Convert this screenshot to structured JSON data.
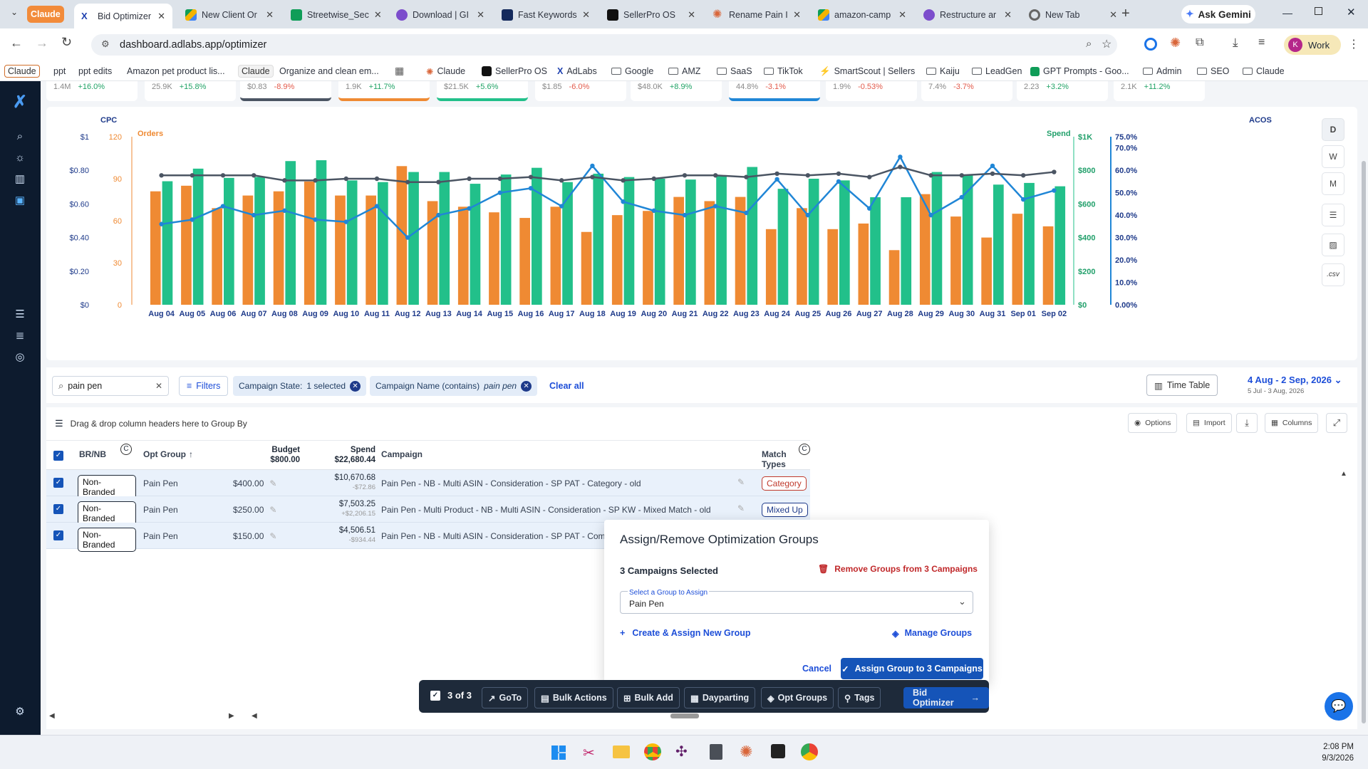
{
  "browser": {
    "tabs": [
      {
        "label": "Claude",
        "active": false
      },
      {
        "label": "Bid Optimizer",
        "active": true
      },
      {
        "label": "New Client Or",
        "active": false
      },
      {
        "label": "Streetwise_Sec",
        "active": false
      },
      {
        "label": "Download | GI",
        "active": false
      },
      {
        "label": "Fast Keywords",
        "active": false
      },
      {
        "label": "SellerPro OS",
        "active": false
      },
      {
        "label": "Rename Pain I",
        "active": false
      },
      {
        "label": "amazon-camp",
        "active": false
      },
      {
        "label": "Restructure ar",
        "active": false
      },
      {
        "label": "New Tab",
        "active": false
      }
    ],
    "ask_gemini": "Ask Gemini",
    "url": "dashboard.adlabs.app/optimizer",
    "profile": "Work",
    "profile_initial": "K",
    "bookmarks": [
      "Claude",
      "ppt",
      "ppt edits",
      "Amazon pet product lis...",
      "Claude",
      "Organize and clean em...",
      "Claude",
      "SellerPro OS",
      "AdLabs",
      "Google",
      "AMZ",
      "SaaS",
      "TikTok",
      "SmartScout | Sellers",
      "Kaiju",
      "LeadGen",
      "GPT Prompts - Goo...",
      "Admin",
      "SEO",
      "Claude"
    ]
  },
  "kpis": [
    {
      "value": "1.4M",
      "delta": "+16.0%",
      "dir": "up"
    },
    {
      "value": "25.9K",
      "delta": "+15.8%",
      "dir": "up"
    },
    {
      "value": "$0.83",
      "delta": "-8.9%",
      "dir": "dn"
    },
    {
      "value": "1.9K",
      "delta": "+11.7%",
      "dir": "up"
    },
    {
      "value": "$21.5K",
      "delta": "+5.6%",
      "dir": "up"
    },
    {
      "value": "$1.85",
      "delta": "-6.0%",
      "dir": "dn"
    },
    {
      "value": "$48.0K",
      "delta": "+8.9%",
      "dir": "up"
    },
    {
      "value": "44.8%",
      "delta": "-3.1%",
      "dir": "dn"
    },
    {
      "value": "1.9%",
      "delta": "-0.53%",
      "dir": "dn"
    },
    {
      "value": "7.4%",
      "delta": "-3.7%",
      "dir": "dn"
    },
    {
      "value": "2.23",
      "delta": "+3.2%",
      "dir": "up"
    },
    {
      "value": "2.1K",
      "delta": "+11.2%",
      "dir": "up"
    }
  ],
  "chart_data": {
    "type": "bar",
    "axis_titles": {
      "cpc": "CPC",
      "orders": "Orders",
      "spend": "Spend",
      "acos": "ACOS"
    },
    "cpc_ticks": [
      "$0",
      "$0.20",
      "$0.40",
      "$0.60",
      "$0.80",
      "$1"
    ],
    "orders_ticks": [
      "0",
      "30",
      "60",
      "90",
      "120"
    ],
    "spend_ticks": [
      "$0",
      "$200",
      "$400",
      "$600",
      "$800",
      "$1K"
    ],
    "acos_ticks": [
      "0.00%",
      "10.0%",
      "20.0%",
      "30.0%",
      "40.0%",
      "50.0%",
      "60.0%",
      "70.0%",
      "75.0%"
    ],
    "categories": [
      "Aug 04",
      "Aug 05",
      "Aug 06",
      "Aug 07",
      "Aug 08",
      "Aug 09",
      "Aug 10",
      "Aug 11",
      "Aug 12",
      "Aug 13",
      "Aug 14",
      "Aug 15",
      "Aug 16",
      "Aug 17",
      "Aug 18",
      "Aug 19",
      "Aug 20",
      "Aug 21",
      "Aug 22",
      "Aug 23",
      "Aug 24",
      "Aug 25",
      "Aug 26",
      "Aug 27",
      "Aug 28",
      "Aug 29",
      "Aug 30",
      "Aug 31",
      "Sep 01",
      "Sep 02"
    ],
    "series": [
      {
        "name": "Orders",
        "color": "#ef8a33",
        "values": [
          81,
          85,
          69,
          78,
          81,
          88,
          78,
          78,
          99,
          74,
          70,
          66,
          62,
          70,
          52,
          64,
          67,
          77,
          74,
          77,
          54,
          69,
          54,
          58,
          39,
          79,
          63,
          48,
          65,
          56
        ]
      },
      {
        "name": "Spend",
        "color": "#22c08a",
        "values": [
          735,
          810,
          755,
          760,
          855,
          860,
          740,
          730,
          790,
          790,
          720,
          775,
          815,
          730,
          780,
          760,
          750,
          745,
          770,
          820,
          690,
          750,
          740,
          640,
          640,
          790,
          770,
          715,
          725,
          705
        ]
      },
      {
        "name": "ACOS",
        "color": "#2086d6",
        "values": [
          36,
          38,
          44,
          40,
          42,
          38,
          37,
          44,
          30,
          40,
          43,
          50,
          52,
          44,
          62,
          46,
          42,
          40,
          44,
          41,
          56,
          40,
          55,
          43,
          66,
          40,
          48,
          62,
          47,
          51
        ]
      },
      {
        "name": "CPC",
        "color": "#4b5563",
        "values": [
          0.77,
          0.77,
          0.77,
          0.77,
          0.74,
          0.74,
          0.75,
          0.75,
          0.73,
          0.73,
          0.75,
          0.75,
          0.76,
          0.74,
          0.76,
          0.74,
          0.75,
          0.77,
          0.77,
          0.76,
          0.78,
          0.77,
          0.78,
          0.76,
          0.82,
          0.77,
          0.77,
          0.78,
          0.77,
          0.79
        ]
      }
    ]
  },
  "period_buttons": [
    "D",
    "W",
    "M"
  ],
  "side_tools": {
    "csv": ".csv"
  },
  "filters": {
    "search_value": "pain pen",
    "filters_label": "Filters",
    "chip1_label": "Campaign State:",
    "chip1_value": "1 selected",
    "chip2_label": "Campaign Name (contains)",
    "chip2_value": "pain pen",
    "clear_all": "Clear all",
    "time_table": "Time Table",
    "date_range": "4 Aug - 2 Sep, 2026",
    "date_compare": "5 Jul - 3 Aug, 2026"
  },
  "grid": {
    "group_by_hint": "Drag & drop column headers here to Group By",
    "toolbar": [
      "Options",
      "Import",
      "Columns"
    ],
    "headers": {
      "brnb": "BR/NB",
      "opt_group": "Opt Group",
      "budget": "Budget",
      "budget_total": "$800.00",
      "spend": "Spend",
      "spend_total": "$22,680.44",
      "campaign": "Campaign",
      "match_types": "Match Types"
    },
    "rows": [
      {
        "brnb": "Non-Branded",
        "group": "Pain Pen",
        "budget": "$400.00",
        "spend": "$10,670.68",
        "spend_delta": "-$72.86",
        "campaign": "Pain Pen - NB - Multi ASIN - Consideration - SP PAT - Category - old",
        "match": "Category",
        "match_color": "#c0392b"
      },
      {
        "brnb": "Non-Branded",
        "group": "Pain Pen",
        "budget": "$250.00",
        "spend": "$7,503.25",
        "spend_delta": "+$2,206.15",
        "campaign": "Pain Pen - Multi Product - NB - Multi ASIN - Consideration - SP KW - Mixed Match - old",
        "match": "Mixed Up",
        "match_color": "#1e3a8a"
      },
      {
        "brnb": "Non-Branded",
        "group": "Pain Pen",
        "budget": "$150.00",
        "spend": "$4,506.51",
        "spend_delta": "-$934.44",
        "campaign": "Pain Pen - NB - Multi ASIN - Consideration - SP PAT - Comp",
        "match": "",
        "match_color": "#1e3a8a"
      }
    ]
  },
  "modal": {
    "title": "Assign/Remove Optimization Groups",
    "selected": "3 Campaigns Selected",
    "remove": "Remove Groups from 3 Campaigns",
    "select_label": "Select a Group to Assign",
    "select_value": "Pain Pen",
    "create": "Create & Assign New Group",
    "manage": "Manage Groups",
    "cancel": "Cancel",
    "assign": "Assign Group to 3 Campaigns"
  },
  "actionbar": {
    "count": "3 of 3",
    "buttons": [
      "GoTo",
      "Bulk Actions",
      "Bulk Add",
      "Dayparting",
      "Opt Groups",
      "Tags"
    ],
    "primary": "Bid Optimizer"
  },
  "taskbar": {
    "time": "2:08 PM",
    "date": "9/3/2026"
  }
}
